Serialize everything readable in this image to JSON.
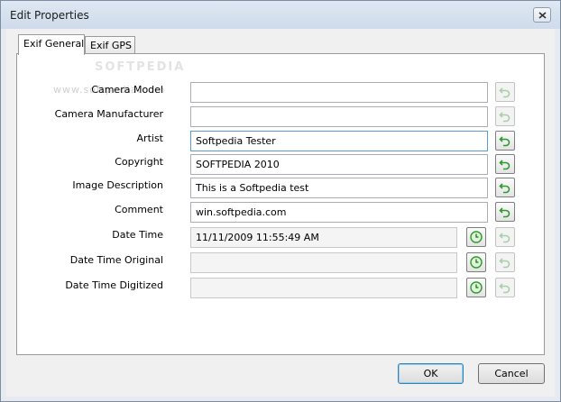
{
  "window": {
    "title": "Edit Properties",
    "watermark_logo": "SOFTPEDIA",
    "watermark_url": "www.softpedia.com"
  },
  "tabs": [
    {
      "label": "Exif General",
      "active": true
    },
    {
      "label": "Exif GPS",
      "active": false
    }
  ],
  "fields": [
    {
      "label": "Camera Model",
      "value": "",
      "enabled": true,
      "has_clock": false
    },
    {
      "label": "Camera Manufacturer",
      "value": "",
      "enabled": true,
      "has_clock": false
    },
    {
      "label": "Artist",
      "value": "Softpedia Tester",
      "enabled": true,
      "has_clock": false
    },
    {
      "label": "Copyright",
      "value": "SOFTPEDIA 2010",
      "enabled": true,
      "has_clock": false
    },
    {
      "label": "Image Description",
      "value": "This is a Softpedia test",
      "enabled": true,
      "has_clock": false
    },
    {
      "label": "Comment",
      "value": "win.softpedia.com",
      "enabled": true,
      "has_clock": false
    },
    {
      "label": "Date Time",
      "value": "11/11/2009 11:55:49 AM",
      "enabled": false,
      "has_clock": true
    },
    {
      "label": "Date Time Original",
      "value": "",
      "enabled": false,
      "has_clock": true
    },
    {
      "label": "Date Time Digitized",
      "value": "",
      "enabled": false,
      "has_clock": true
    }
  ],
  "buttons": {
    "ok": "OK",
    "cancel": "Cancel"
  },
  "icons": {
    "revert": "undo-arrow-icon",
    "clock": "clock-icon",
    "close": "close-icon"
  },
  "colors": {
    "icon_green": "#2e9b2e",
    "icon_disabled": "#a9cfa9"
  }
}
